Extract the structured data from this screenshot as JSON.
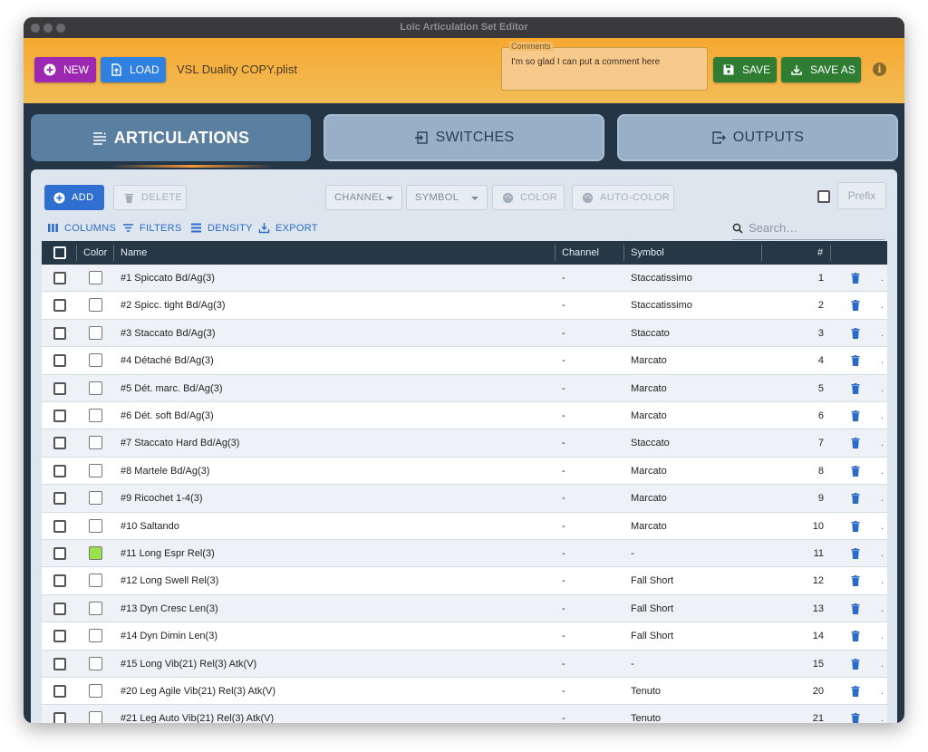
{
  "window": {
    "title": "Loïc Articulation Set Editor"
  },
  "header": {
    "new_label": "NEW",
    "load_label": "LOAD",
    "filename": "VSL Duality COPY.plist",
    "comments_label": "Comments",
    "comments_value": "I'm so glad I can put a comment here",
    "save_label": "SAVE",
    "save_as_label": "SAVE AS",
    "info_glyph": "i",
    "colors": {
      "new": "#9c27b0",
      "load": "#2f80e0",
      "save": "#2e7d32",
      "header_from": "#f6a830",
      "header_to": "#f2bd57"
    }
  },
  "tabs": [
    {
      "label": "ARTICULATIONS",
      "icon": "list-icon",
      "active": true
    },
    {
      "label": "SWITCHES",
      "icon": "login-icon",
      "active": false
    },
    {
      "label": "OUTPUTS",
      "icon": "logout-icon",
      "active": false
    }
  ],
  "toolbar": {
    "add_label": "ADD",
    "delete_label": "DELETE",
    "channel_label": "CHANNEL",
    "symbol_label": "SYMBOL",
    "color_label": "COLOR",
    "auto_color_label": "AUTO-COLOR",
    "prefix_label": "Prefix",
    "columns_label": "COLUMNS",
    "filters_label": "FILTERS",
    "density_label": "DENSITY",
    "export_label": "EXPORT",
    "search_placeholder": "Search…"
  },
  "table": {
    "headers": {
      "color": "Color",
      "name": "Name",
      "channel": "Channel",
      "symbol": "Symbol",
      "number": "#"
    },
    "rows": [
      {
        "name": "#1 Spiccato Bd/Ag(3)",
        "channel": "-",
        "symbol": "Staccatissimo",
        "num": "1",
        "color": "#ffffff"
      },
      {
        "name": "#2 Spicc. tight Bd/Ag(3)",
        "channel": "-",
        "symbol": "Staccatissimo",
        "num": "2",
        "color": "#ffffff"
      },
      {
        "name": "#3 Staccato Bd/Ag(3)",
        "channel": "-",
        "symbol": "Staccato",
        "num": "3",
        "color": "#ffffff"
      },
      {
        "name": "#4 Détaché Bd/Ag(3)",
        "channel": "-",
        "symbol": "Marcato",
        "num": "4",
        "color": "#ffffff"
      },
      {
        "name": "#5 Dét. marc. Bd/Ag(3)",
        "channel": "-",
        "symbol": "Marcato",
        "num": "5",
        "color": "#ffffff"
      },
      {
        "name": "#6 Dét. soft Bd/Ag(3)",
        "channel": "-",
        "symbol": "Marcato",
        "num": "6",
        "color": "#ffffff"
      },
      {
        "name": "#7 Staccato Hard Bd/Ag(3)",
        "channel": "-",
        "symbol": "Staccato",
        "num": "7",
        "color": "#ffffff"
      },
      {
        "name": "#8 Martele Bd/Ag(3)",
        "channel": "-",
        "symbol": "Marcato",
        "num": "8",
        "color": "#ffffff"
      },
      {
        "name": "#9 Ricochet 1-4(3)",
        "channel": "-",
        "symbol": "Marcato",
        "num": "9",
        "color": "#ffffff"
      },
      {
        "name": "#10 Saltando",
        "channel": "-",
        "symbol": "Marcato",
        "num": "10",
        "color": "#ffffff"
      },
      {
        "name": "#11 Long Espr Rel(3)",
        "channel": "-",
        "symbol": "-",
        "num": "11",
        "color": "#9be24a"
      },
      {
        "name": "#12 Long Swell Rel(3)",
        "channel": "-",
        "symbol": "Fall Short",
        "num": "12",
        "color": "#ffffff"
      },
      {
        "name": "#13 Dyn Cresc Len(3)",
        "channel": "-",
        "symbol": "Fall Short",
        "num": "13",
        "color": "#ffffff"
      },
      {
        "name": "#14 Dyn Dimin Len(3)",
        "channel": "-",
        "symbol": "Fall Short",
        "num": "14",
        "color": "#ffffff"
      },
      {
        "name": "#15 Long Vib(21) Rel(3) Atk(V)",
        "channel": "-",
        "symbol": "-",
        "num": "15",
        "color": "#ffffff"
      },
      {
        "name": "#20 Leg Agile Vib(21) Rel(3) Atk(V)",
        "channel": "-",
        "symbol": "Tenuto",
        "num": "20",
        "color": "#ffffff"
      },
      {
        "name": "#21 Leg Auto Vib(21) Rel(3) Atk(V)",
        "channel": "-",
        "symbol": "Tenuto",
        "num": "21",
        "color": "#ffffff"
      }
    ]
  }
}
